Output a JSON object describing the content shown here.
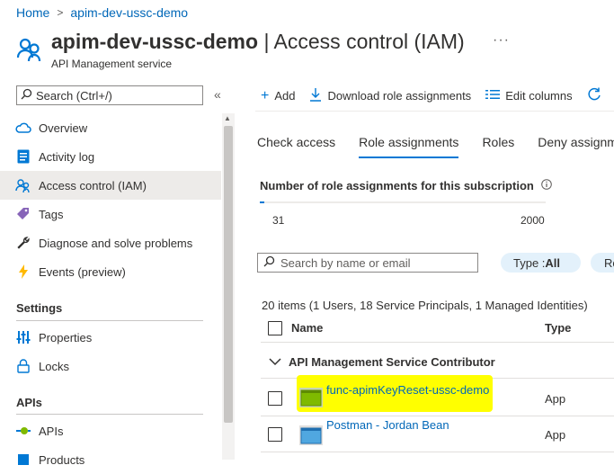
{
  "breadcrumb": {
    "home": "Home",
    "resource": "apim-dev-ussc-demo"
  },
  "header": {
    "title_bold": "apim-dev-ussc-demo",
    "title_rest": " | Access control (IAM)",
    "subtitle": "API Management service",
    "more": "···"
  },
  "sidebar": {
    "search_placeholder": "Search (Ctrl+/)",
    "collapse": "«",
    "items": [
      {
        "label": "Overview",
        "icon": "cloud-icon"
      },
      {
        "label": "Activity log",
        "icon": "activity-log-icon"
      },
      {
        "label": "Access control (IAM)",
        "icon": "people-icon"
      },
      {
        "label": "Tags",
        "icon": "tag-icon"
      },
      {
        "label": "Diagnose and solve problems",
        "icon": "wrench-icon"
      },
      {
        "label": "Events (preview)",
        "icon": "lightning-icon"
      }
    ],
    "settings_heading": "Settings",
    "settings_items": [
      {
        "label": "Properties",
        "icon": "properties-icon"
      },
      {
        "label": "Locks",
        "icon": "lock-icon"
      }
    ],
    "apis_heading": "APIs",
    "apis_items": [
      {
        "label": "APIs",
        "icon": "api-icon"
      },
      {
        "label": "Products",
        "icon": "products-icon"
      }
    ]
  },
  "toolbar": {
    "add": "Add",
    "download": "Download role assignments",
    "edit_columns": "Edit columns"
  },
  "tabs": [
    "Check access",
    "Role assignments",
    "Roles",
    "Deny assignments"
  ],
  "stats": {
    "title": "Number of role assignments for this subscription",
    "current": "31",
    "max": "2000",
    "progress_fraction": 0.0155
  },
  "filter": {
    "search_placeholder": "Search by name or email",
    "type_label": "Type : ",
    "type_value": "All",
    "role_pill": "Ro"
  },
  "table": {
    "count_text": "20 items (1 Users, 18 Service Principals, 1 Managed Identities)",
    "col_name": "Name",
    "col_type": "Type",
    "group": "API Management Service Contributor",
    "rows": [
      {
        "name": "func-apimKeyReset-ussc-demo",
        "type": "App",
        "icon": "function-app-icon",
        "highlighted": true
      },
      {
        "name": "Postman - Jordan Bean",
        "type": "App",
        "icon": "app-registration-icon",
        "highlighted": false
      }
    ]
  },
  "colors": {
    "accent": "#0078d4",
    "link": "#0067b8",
    "highlight": "#ffff00"
  }
}
